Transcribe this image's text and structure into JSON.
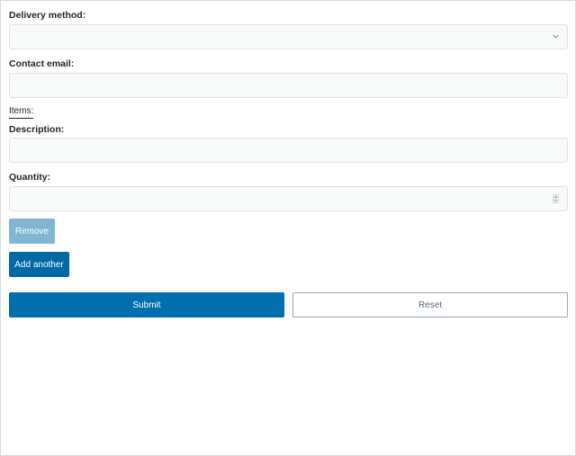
{
  "form": {
    "delivery_method": {
      "label": "Delivery method:",
      "value": ""
    },
    "contact_email": {
      "label": "Contact email:",
      "value": "",
      "placeholder": ""
    },
    "items": {
      "legend": "Items:",
      "description": {
        "label": "Description:",
        "value": "",
        "placeholder": ""
      },
      "quantity": {
        "label": "Quantity:",
        "value": "",
        "placeholder": ""
      },
      "remove_label": "Remove",
      "add_label": "Add another"
    },
    "submit_label": "Submit",
    "reset_label": "Reset"
  },
  "colors": {
    "primary": "#0069a6",
    "primary_disabled": "#80b6d2",
    "field_bg": "#f8faf9",
    "field_border": "#dde2e6"
  },
  "icons": {
    "select": "chevron-down-icon",
    "stepper": "spinner-arrows-icon"
  }
}
